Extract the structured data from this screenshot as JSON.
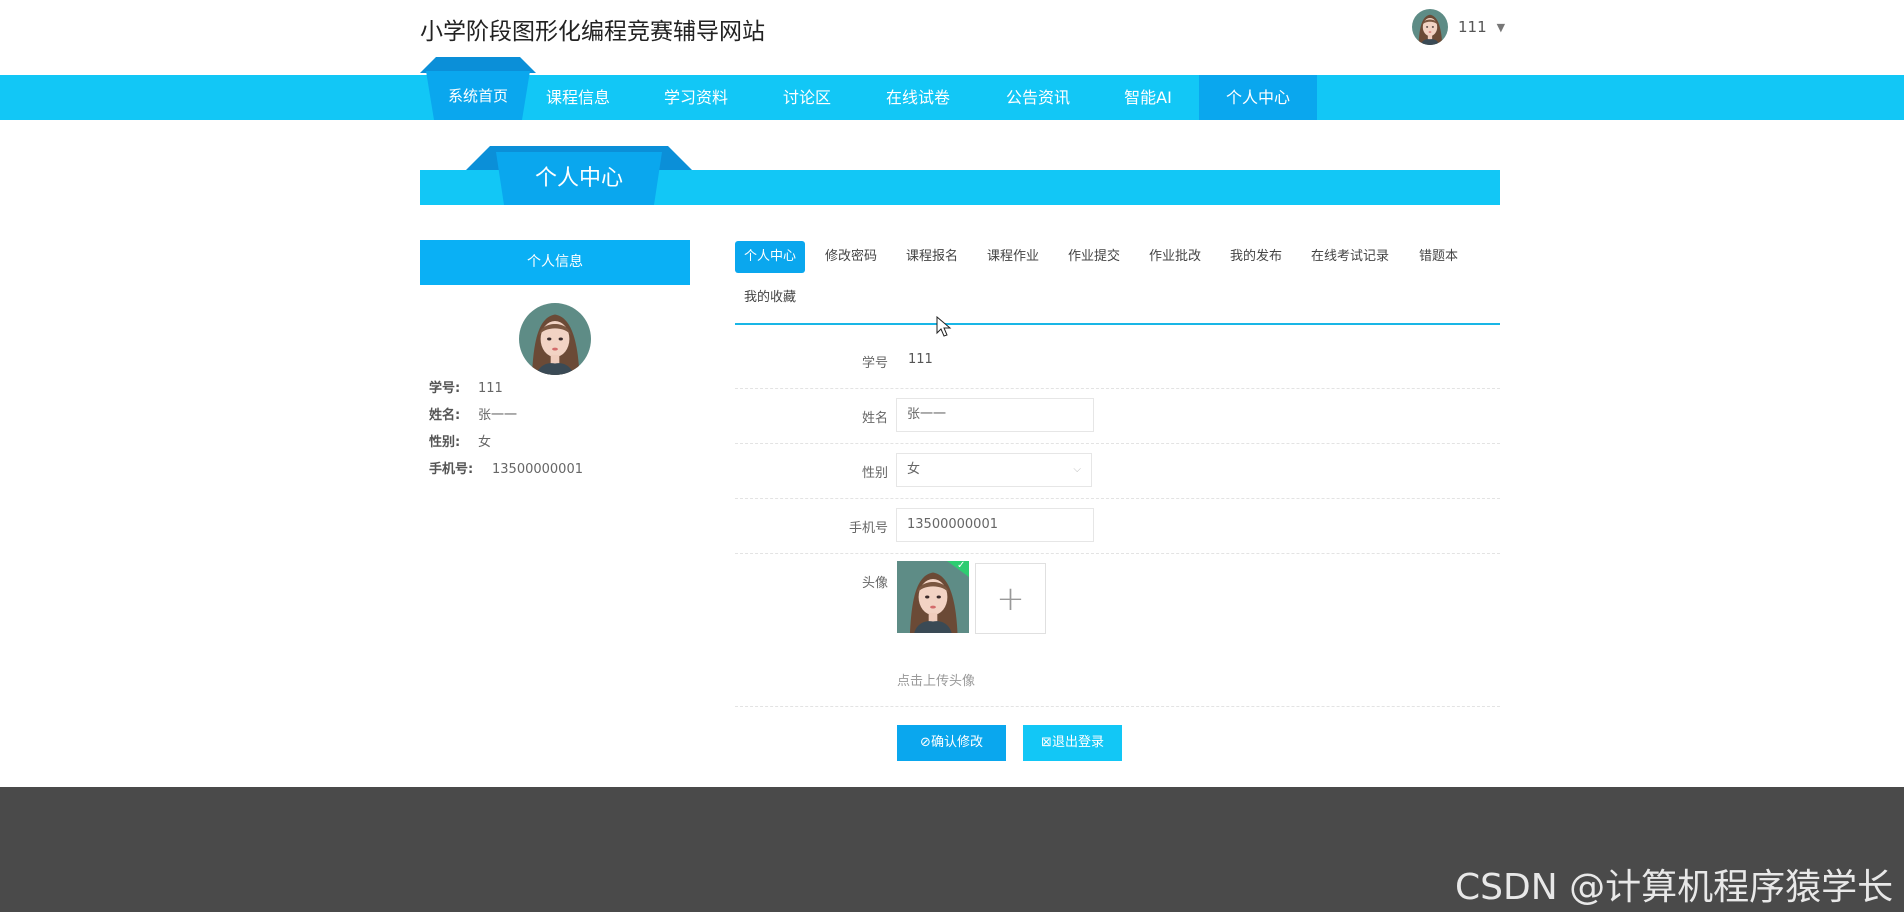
{
  "header": {
    "site_title": "小学阶段图形化编程竞赛辅导网站",
    "username": "111"
  },
  "nav": {
    "home": "系统首页",
    "items": [
      "课程信息",
      "学习资料",
      "讨论区",
      "在线试卷",
      "公告资讯",
      "智能AI",
      "个人中心"
    ],
    "active": "个人中心"
  },
  "page_banner": "个人中心",
  "sidebar": {
    "title": "个人信息",
    "fields": [
      {
        "label": "学号:",
        "value": "111"
      },
      {
        "label": "姓名:",
        "value": "张一一"
      },
      {
        "label": "性别:",
        "value": "女"
      },
      {
        "label": "手机号:",
        "value": "13500000001"
      }
    ]
  },
  "tabs": [
    "个人中心",
    "修改密码",
    "课程报名",
    "课程作业",
    "作业提交",
    "作业批改",
    "我的发布",
    "在线考试记录",
    "错题本",
    "我的收藏"
  ],
  "active_tab": "个人中心",
  "form": {
    "student_id": {
      "label": "学号",
      "value": "111"
    },
    "name": {
      "label": "姓名",
      "value": "张一一"
    },
    "gender": {
      "label": "性别",
      "value": "女"
    },
    "phone": {
      "label": "手机号",
      "value": "13500000001"
    },
    "avatar": {
      "label": "头像",
      "hint": "点击上传头像"
    }
  },
  "buttons": {
    "confirm": "确认修改",
    "logout": "退出登录"
  },
  "watermark": "CSDN @计算机程序猿学长",
  "colors": {
    "primary": "#12c7f6",
    "active": "#0aa7ee",
    "footer": "#4a4a4a"
  }
}
